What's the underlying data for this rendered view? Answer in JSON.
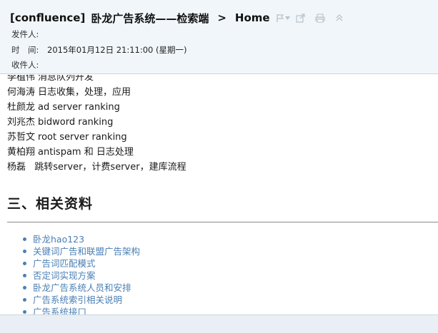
{
  "header": {
    "subject_tag": "[confluence]",
    "subject_title": "卧龙广告系统——检索端",
    "subject_separator": ">",
    "subject_page": "Home",
    "from_label": "发件人:",
    "from_value": "",
    "time_label": "时　间:",
    "time_value": "2015年01月12日 21:11:00 (星期一)",
    "to_label": "收件人:",
    "to_value": ""
  },
  "content": {
    "members": [
      {
        "name": "李植伟",
        "duty": "消息队列开发"
      },
      {
        "name": "何海涛",
        "duty": "日志收集，处理，应用"
      },
      {
        "name": "杜颜龙",
        "duty": "ad server ranking"
      },
      {
        "name": "刘兆杰",
        "duty": "bidword ranking"
      },
      {
        "name": "苏哲文",
        "duty": "root server ranking"
      },
      {
        "name": "黄柏翔",
        "duty": "antispam 和 日志处理"
      },
      {
        "name": "杨磊",
        "duty": "  跳转server，计费server，建库流程"
      }
    ],
    "section_title": "三、相关资料",
    "links": [
      "卧龙hao123",
      "关键词广告和联盟广告架构",
      "广告词匹配模式",
      "否定词实现方案",
      "卧龙广告系统人员和安排",
      "广告系统索引相关说明",
      "广告系统接口"
    ]
  },
  "colors": {
    "header_bg": "#f1f6fa",
    "link": "#4a7fb5"
  },
  "icons": [
    "flag-icon",
    "dropdown-arrow-icon",
    "popout-icon",
    "print-icon",
    "collapse-icon"
  ]
}
